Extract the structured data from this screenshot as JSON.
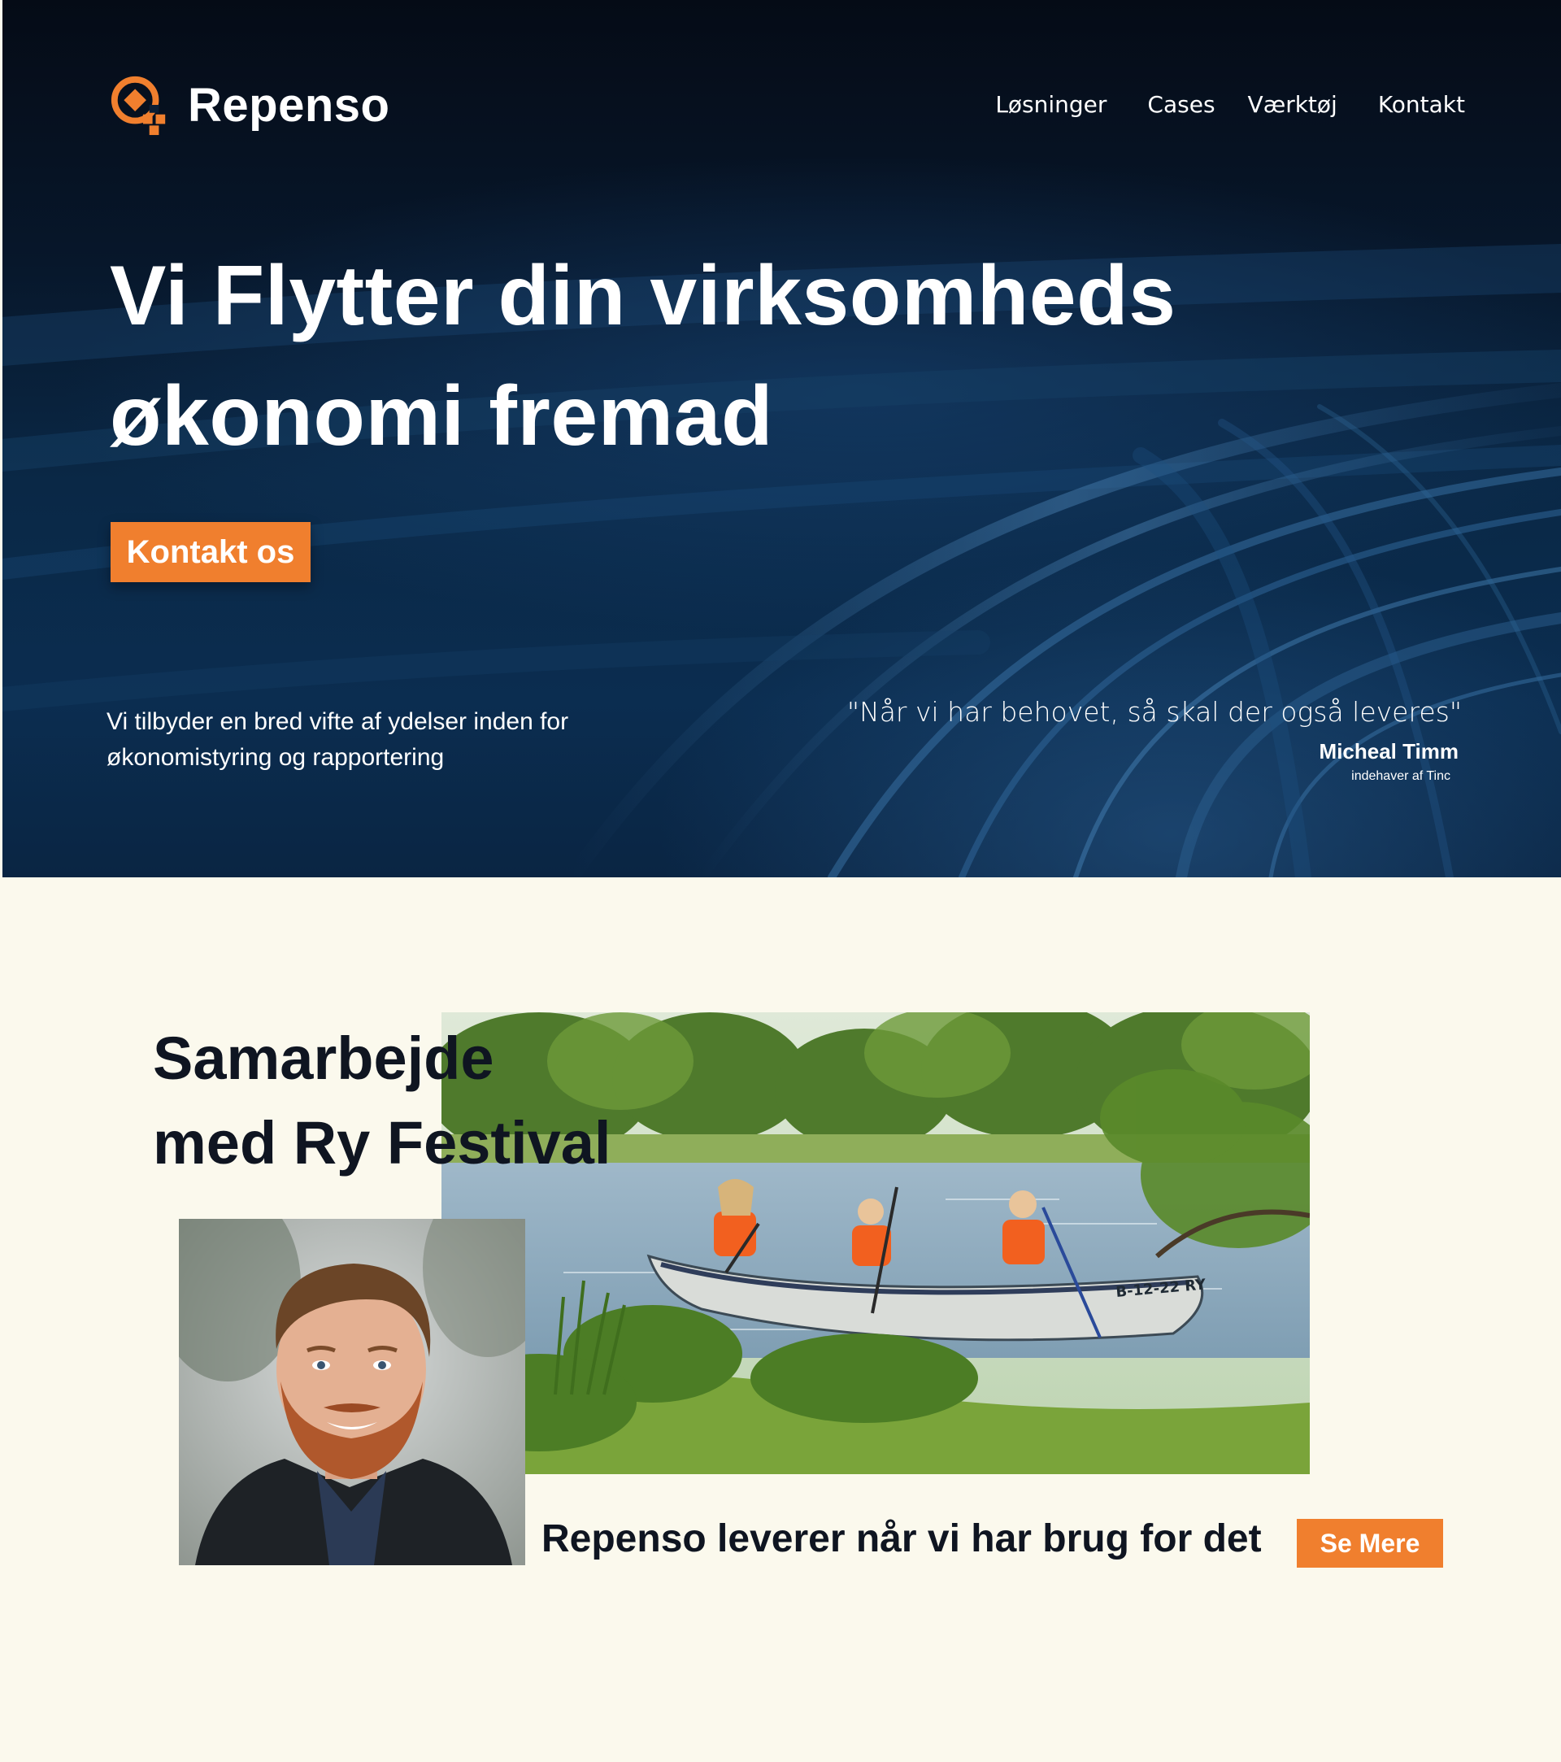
{
  "brand": {
    "name": "Repenso",
    "accent_color": "#f07f2e",
    "hero_color": "#0a2846",
    "background_color": "#fbf9ed"
  },
  "nav": {
    "items": [
      {
        "label": "Løsninger"
      },
      {
        "label": "Cases"
      },
      {
        "label": "Værktøj"
      },
      {
        "label": "Kontakt"
      }
    ]
  },
  "hero": {
    "title_line1": "Vi Flytter din virksomheds",
    "title_line2": "økonomi fremad",
    "cta_label": "Kontakt os",
    "subtitle_line1": "Vi tilbyder en bred vifte af ydelser inden for",
    "subtitle_line2": "økonomistyring og rapportering",
    "quote": {
      "text": "\"Når vi har behovet, så skal der også leveres\"",
      "author": "Micheal Timm",
      "role": "indehaver af Tinc"
    }
  },
  "case": {
    "title_line1": "Samarbejde",
    "title_line2": "med Ry Festival",
    "tagline": "Repenso leverer når vi har brug for det",
    "button_label": "Se Mere",
    "canoe_marking": "B-12-22 RY"
  },
  "icons": {
    "logo": "repenso-logo-icon"
  }
}
